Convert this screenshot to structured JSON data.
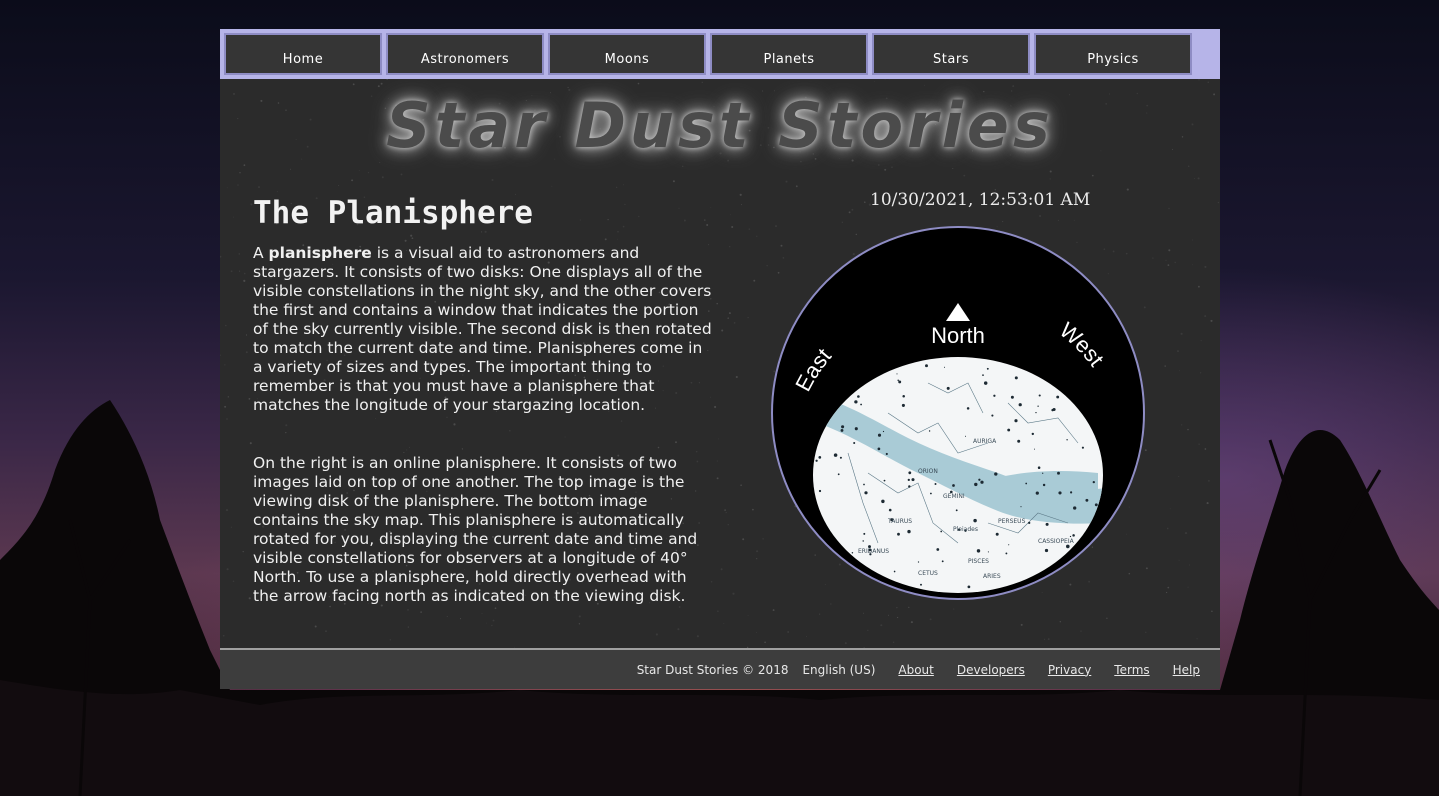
{
  "nav": {
    "items": [
      "Home",
      "Astronomers",
      "Moons",
      "Planets",
      "Stars",
      "Physics"
    ]
  },
  "banner": {
    "title": "Star Dust Stories"
  },
  "article": {
    "heading": "The Planisphere",
    "p1_intro": "A ",
    "p1_bold": "planisphere",
    "p1_rest": " is a visual aid to astronomers and stargazers. It consists of two disks: One displays all of the visible constellations in the night sky, and the other covers the first and contains a window that indicates the portion of the sky currently visible. The second disk is then rotated to match the current date and time. Planispheres come in a variety of sizes and types. The important thing to remember is that you must have a planisphere that matches the longitude of your stargazing location.",
    "p2": "On the right is an online planisphere. It consists of two images laid on top of one another. The top image is the viewing disk of the planisphere. The bottom image contains the sky map. This planisphere is automatically rotated for you, displaying the current date and time and visible constellations for observers at a longitude of 40° North. To use a planisphere, hold directly overhead with the arrow facing north as indicated on the viewing disk."
  },
  "clock": {
    "datetime": "10/30/2021, 12:53:01 AM"
  },
  "planisphere": {
    "north": "North",
    "east": "East",
    "west": "West",
    "constellation_labels": [
      "AURIGA",
      "TAURUS",
      "ORION",
      "GEMINI",
      "PERSEUS",
      "CASSIOPEIA",
      "PISCES",
      "ARIES",
      "CETUS",
      "ERIDANUS",
      "Pleiades"
    ]
  },
  "footer": {
    "copyright": "Star Dust Stories © 2018",
    "language": "English (US)",
    "links": [
      "About",
      "Developers",
      "Privacy",
      "Terms",
      "Help"
    ]
  },
  "colors": {
    "nav_bg": "#b6b4e8",
    "panel_bg": "#2b2b2b",
    "milky_way": "#a9cbd6"
  }
}
